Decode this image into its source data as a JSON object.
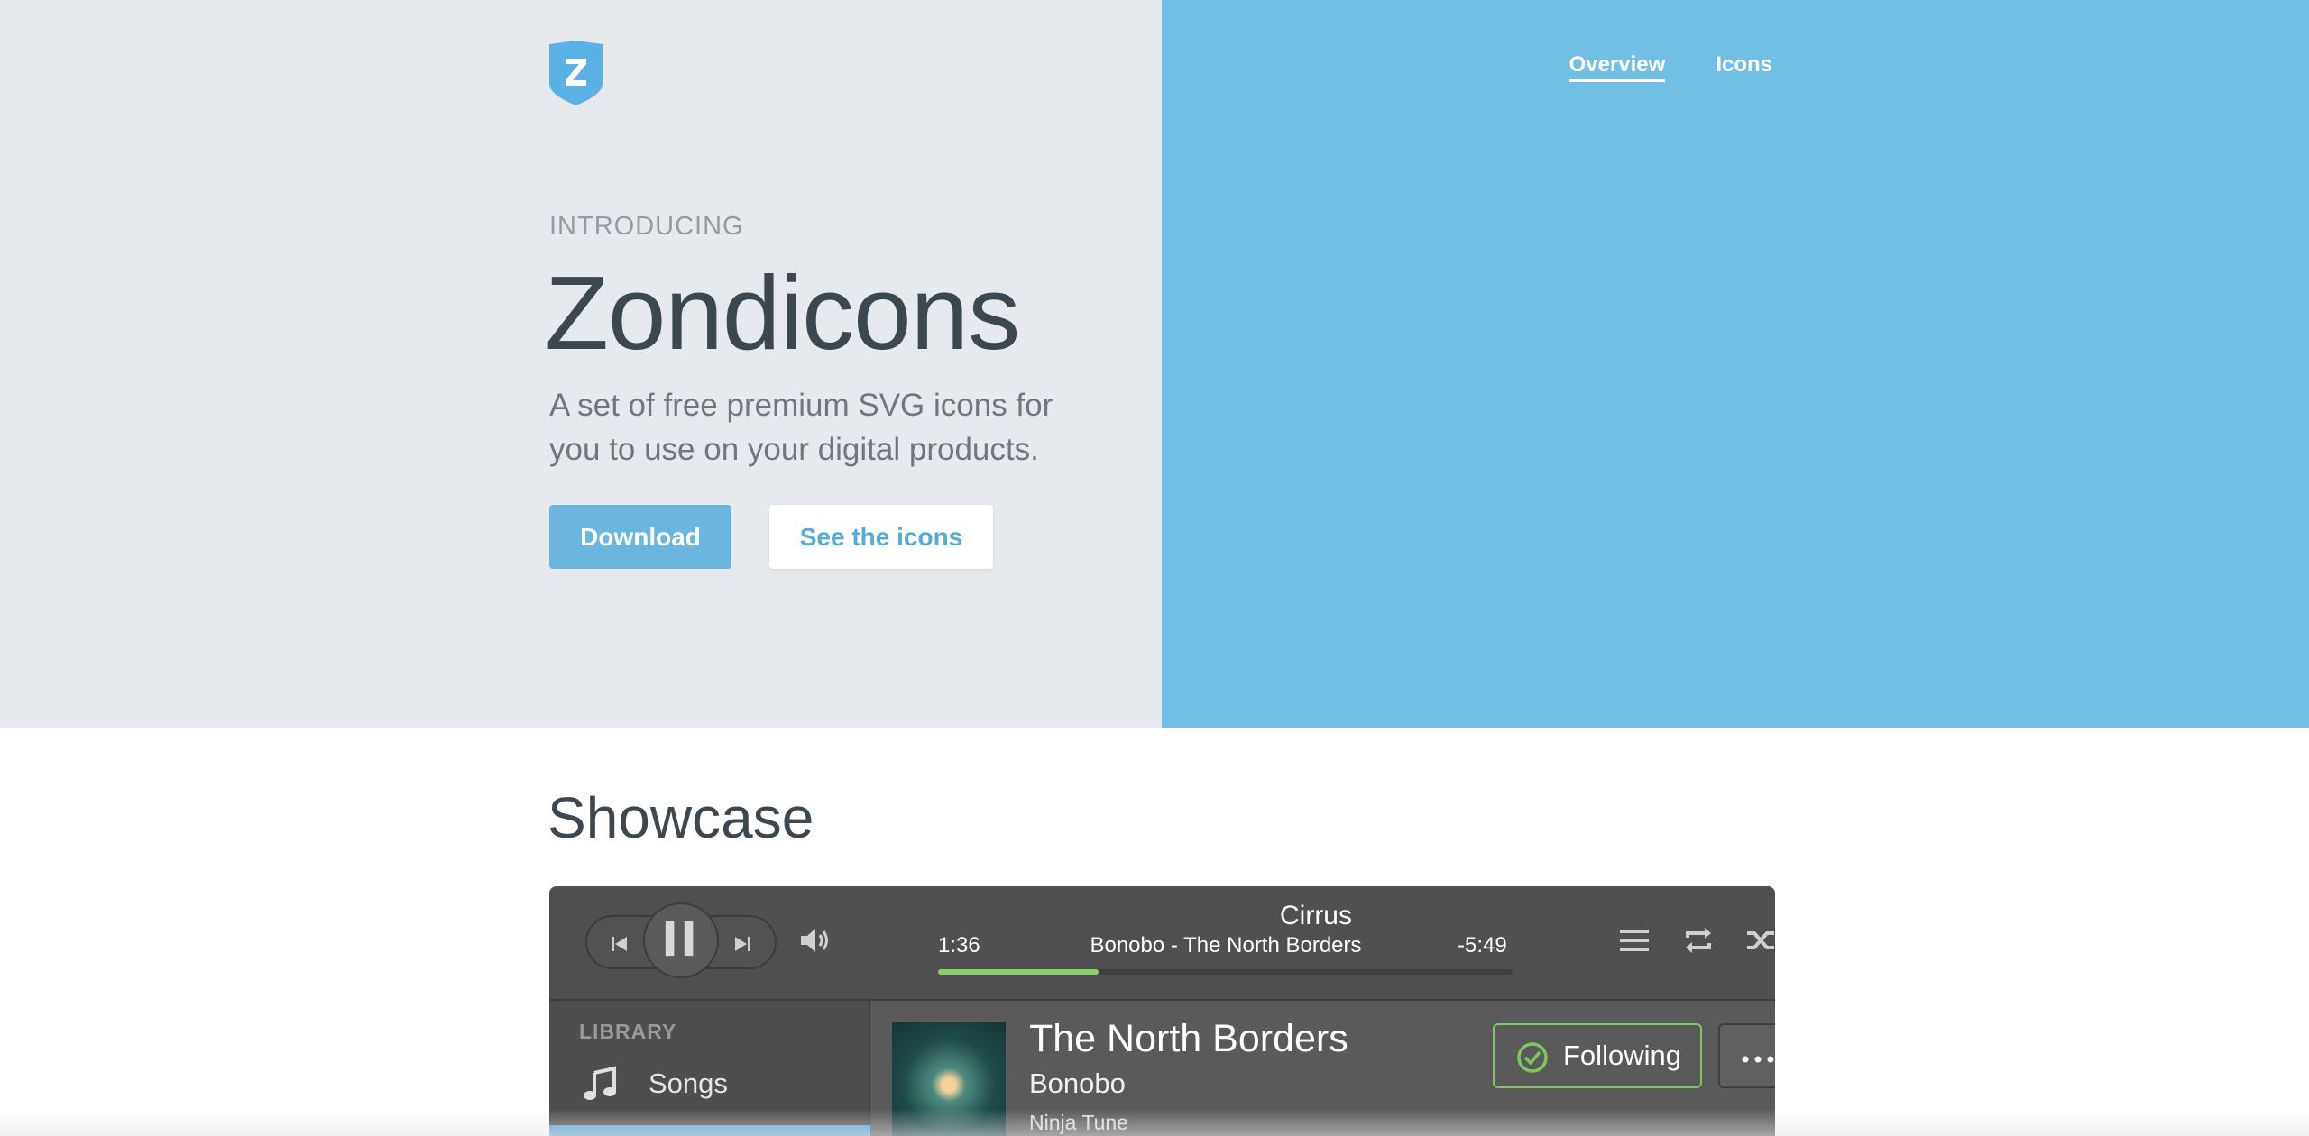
{
  "colors": {
    "hero_left": "#e6e9ed",
    "hero_right": "#72bfe6",
    "primary": "#6bb6e0",
    "progress": "#8ad16b",
    "following": "#7dc761"
  },
  "header": {
    "logo_icon": "zondicons-shield-logo-icon",
    "nav": {
      "overview": "Overview",
      "icons": "Icons"
    }
  },
  "hero": {
    "eyebrow": "INTRODUCING",
    "title": "Zondicons",
    "subtitle": "A set of free premium SVG icons for you to use on your digital products.",
    "download_label": "Download",
    "see_icons_label": "See the icons"
  },
  "showcase": {
    "title": "Showcase",
    "player": {
      "track_title": "Cirrus",
      "track_subtitle": "Bonobo - The North Borders",
      "time_elapsed": "1:36",
      "time_remaining": "-5:49",
      "progress_fraction": 0.28,
      "icons": [
        "previous-icon",
        "pause-icon",
        "next-icon",
        "volume-icon",
        "queue-icon",
        "repeat-icon",
        "shuffle-icon"
      ],
      "sidebar": {
        "heading": "LIBRARY",
        "songs_label": "Songs"
      },
      "album": {
        "title": "The North Borders",
        "artist": "Bonobo",
        "label": "Ninja Tune",
        "following_label": "Following"
      }
    }
  }
}
